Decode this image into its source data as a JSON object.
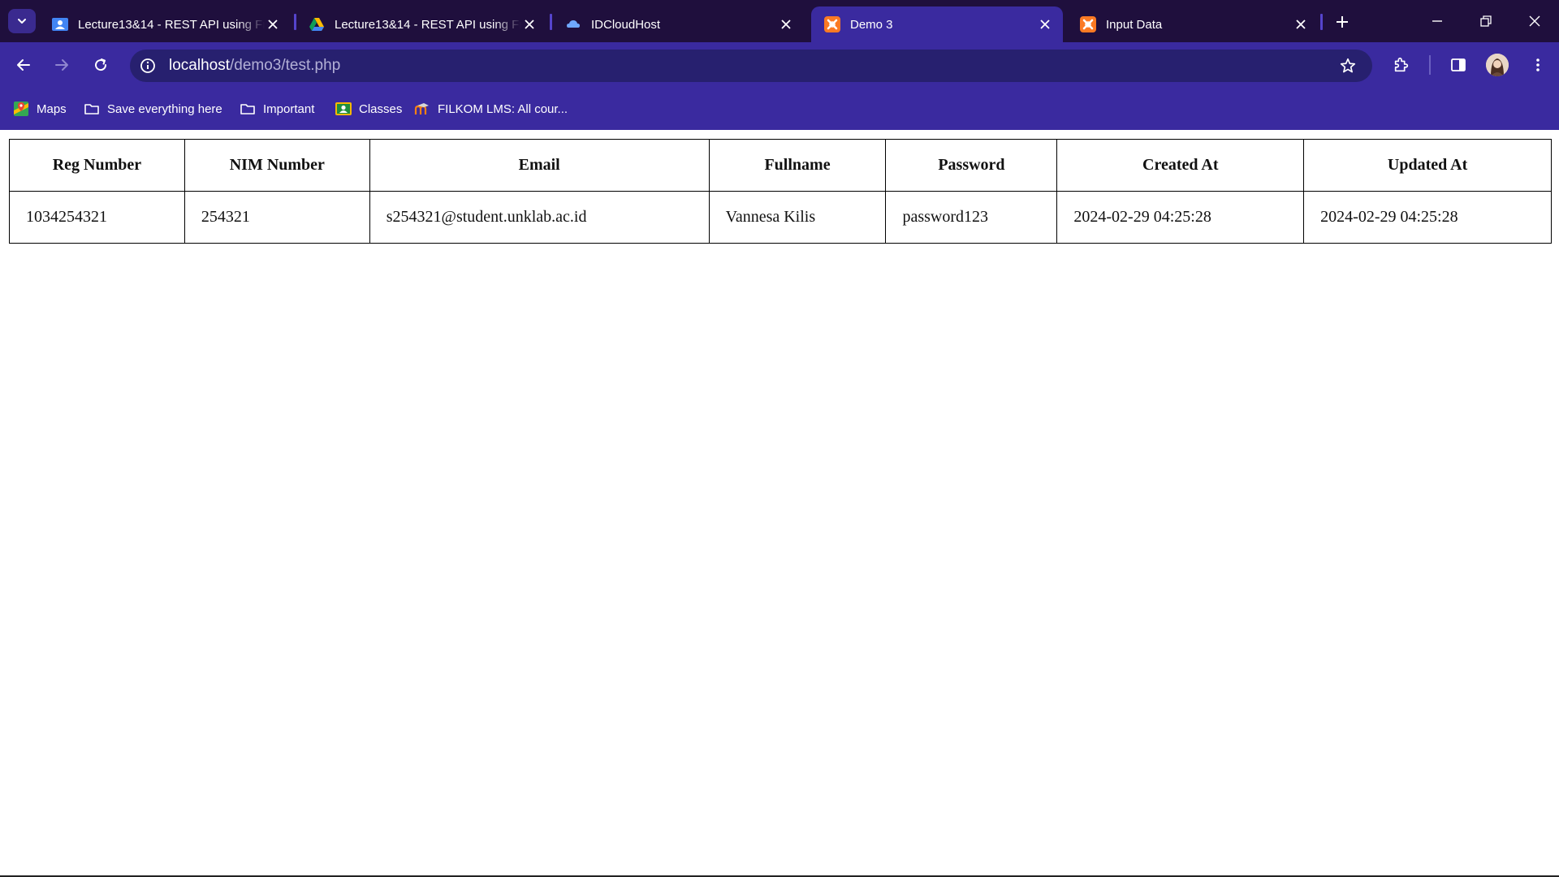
{
  "tabs": [
    {
      "title": "Lecture13&14 - REST API using Fra",
      "icon": "google-classroom-icon"
    },
    {
      "title": "Lecture13&14 - REST API using Fra",
      "icon": "google-drive-icon"
    },
    {
      "title": "IDCloudHost",
      "icon": "idcloudhost-cloud-icon"
    },
    {
      "title": "Demo 3",
      "icon": "xampp-icon",
      "active": true
    },
    {
      "title": "Input Data",
      "icon": "xampp-icon"
    }
  ],
  "address_bar": {
    "host": "localhost",
    "path": "/demo3/test.php"
  },
  "bookmarks": [
    {
      "label": "Maps",
      "icon": "google-maps-icon"
    },
    {
      "label": "Save everything here",
      "icon": "folder-icon"
    },
    {
      "label": "Important",
      "icon": "folder-icon"
    },
    {
      "label": "Classes",
      "icon": "google-classroom-icon"
    },
    {
      "label": "FILKOM LMS: All cour...",
      "icon": "moodle-icon"
    }
  ],
  "table": {
    "headers": [
      "Reg Number",
      "NIM Number",
      "Email",
      "Fullname",
      "Password",
      "Created At",
      "Updated At"
    ],
    "rows": [
      [
        "1034254321",
        "254321",
        "s254321@student.unklab.ac.id",
        "Vannesa Kilis",
        "password123",
        "2024-02-29 04:25:28",
        "2024-02-29 04:25:28"
      ]
    ]
  },
  "colors": {
    "tab_strip": "#1f0f3d",
    "toolbar": "#3a2a9f",
    "omnibox": "#27206f"
  }
}
